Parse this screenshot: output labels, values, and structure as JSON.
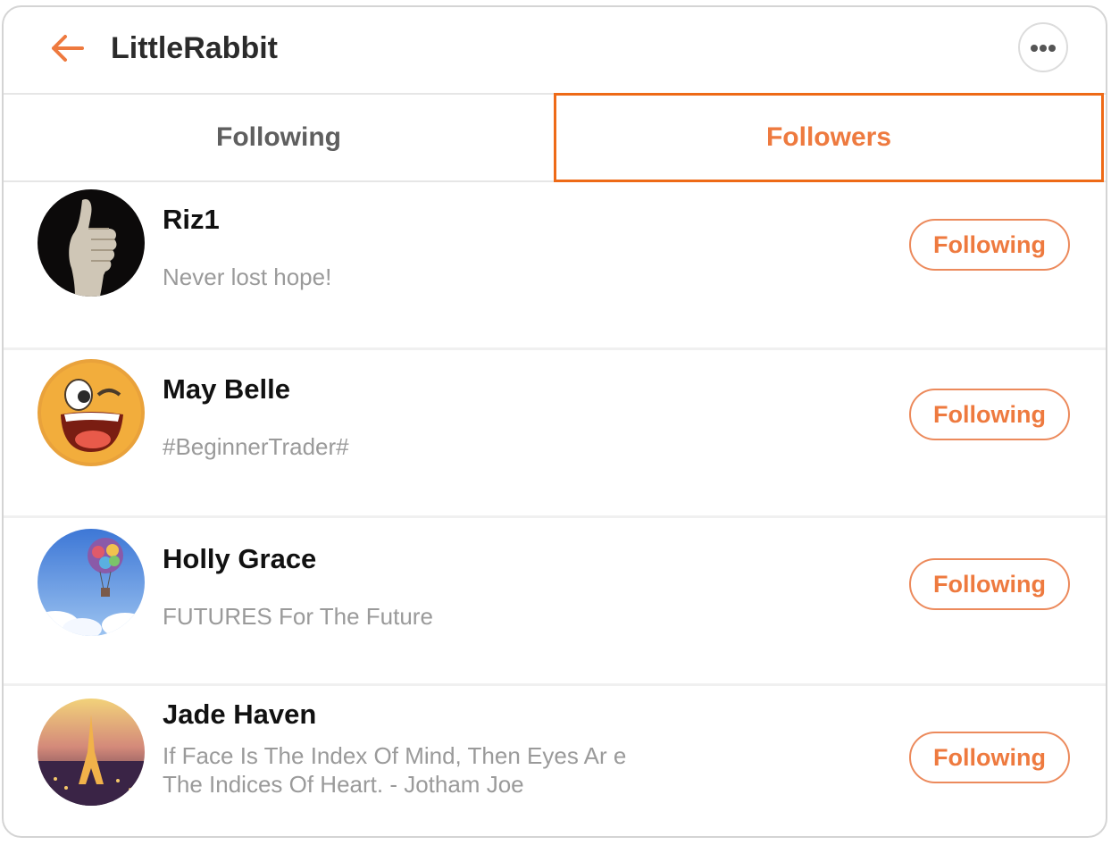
{
  "header": {
    "title": "LittleRabbit",
    "back_icon": "arrow-left-icon",
    "more_icon": "more-dots-icon",
    "accent_color": "#ee7a3f"
  },
  "tabs": [
    {
      "label": "Following",
      "active": false
    },
    {
      "label": "Followers",
      "active": true
    }
  ],
  "followers": [
    {
      "name": "Riz1",
      "bio": "Never lost hope!",
      "button": "Following",
      "avatar": "thumbs-up-avatar"
    },
    {
      "name": "May Belle",
      "bio": "#BeginnerTrader#",
      "button": "Following",
      "avatar": "winking-face-avatar"
    },
    {
      "name": "Holly Grace",
      "bio": "FUTURES For The Future",
      "button": "Following",
      "avatar": "balloon-house-avatar"
    },
    {
      "name": "Jade Haven",
      "bio": "If Face Is The Index Of Mind, Then Eyes Ar e The Indices Of Heart. - Jotham Joe",
      "button": "Following",
      "avatar": "eiffel-tower-avatar"
    }
  ]
}
